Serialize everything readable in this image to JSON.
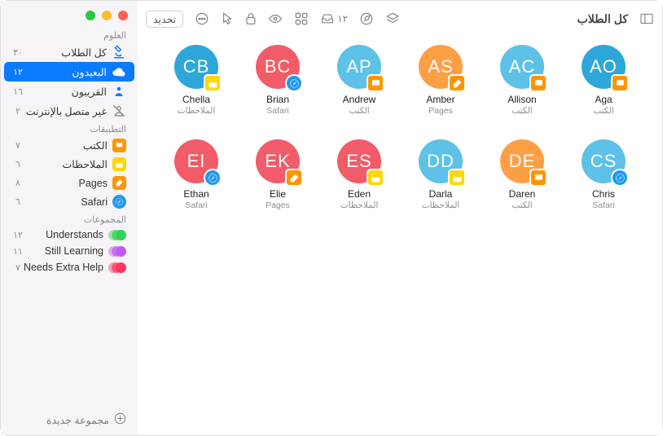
{
  "traffic": {
    "close": "close",
    "min": "minimize",
    "max": "maximize"
  },
  "sections": {
    "subject": "العلوم",
    "apps": "التطبيقات",
    "groups": "المجموعات"
  },
  "sidebar": {
    "all": {
      "label": "كل الطلاب",
      "count": "٣٠"
    },
    "remote": {
      "label": "البعيدون",
      "count": "١٢"
    },
    "nearby": {
      "label": "القريبون",
      "count": "١٦"
    },
    "offline": {
      "label": "غير متصل بالإنترنت",
      "count": "٢"
    },
    "books": {
      "label": "الكتب",
      "count": "٧"
    },
    "notes": {
      "label": "الملاحظات",
      "count": "٦"
    },
    "pages": {
      "label": "Pages",
      "count": "٨"
    },
    "safari": {
      "label": "Safari",
      "count": "٦"
    },
    "g1": {
      "label": "Understands",
      "count": "١٢"
    },
    "g2": {
      "label": "Still Learning",
      "count": "١١"
    },
    "g3": {
      "label": "Needs Extra Help",
      "count": "٧"
    }
  },
  "footer": {
    "new_group": "مجموعة جديدة"
  },
  "toolbar": {
    "title": "كل الطلاب",
    "inbox_count": "١٢",
    "select": "تحديد"
  },
  "students": [
    {
      "initials": "AO",
      "name": "Aga",
      "app": "الكتب",
      "color": "c-b1",
      "app_icon": "books"
    },
    {
      "initials": "AC",
      "name": "Allison",
      "app": "الكتب",
      "color": "c-b2",
      "app_icon": "books"
    },
    {
      "initials": "AS",
      "name": "Amber",
      "app": "Pages",
      "color": "c-o",
      "app_icon": "pages"
    },
    {
      "initials": "AP",
      "name": "Andrew",
      "app": "الكتب",
      "color": "c-b2",
      "app_icon": "books"
    },
    {
      "initials": "BC",
      "name": "Brian",
      "app": "Safari",
      "color": "c-r",
      "app_icon": "safari"
    },
    {
      "initials": "CB",
      "name": "Chella",
      "app": "الملاحظات",
      "color": "c-b1",
      "app_icon": "notes"
    },
    {
      "initials": "CS",
      "name": "Chris",
      "app": "Safari",
      "color": "c-b2",
      "app_icon": "safari"
    },
    {
      "initials": "DE",
      "name": "Daren",
      "app": "الكتب",
      "color": "c-o",
      "app_icon": "books"
    },
    {
      "initials": "DD",
      "name": "Darla",
      "app": "الملاحظات",
      "color": "c-b2",
      "app_icon": "notes"
    },
    {
      "initials": "ES",
      "name": "Eden",
      "app": "الملاحظات",
      "color": "c-r",
      "app_icon": "notes"
    },
    {
      "initials": "EK",
      "name": "Elie",
      "app": "Pages",
      "color": "c-r",
      "app_icon": "pages"
    },
    {
      "initials": "EI",
      "name": "Ethan",
      "app": "Safari",
      "color": "c-r",
      "app_icon": "safari"
    }
  ]
}
